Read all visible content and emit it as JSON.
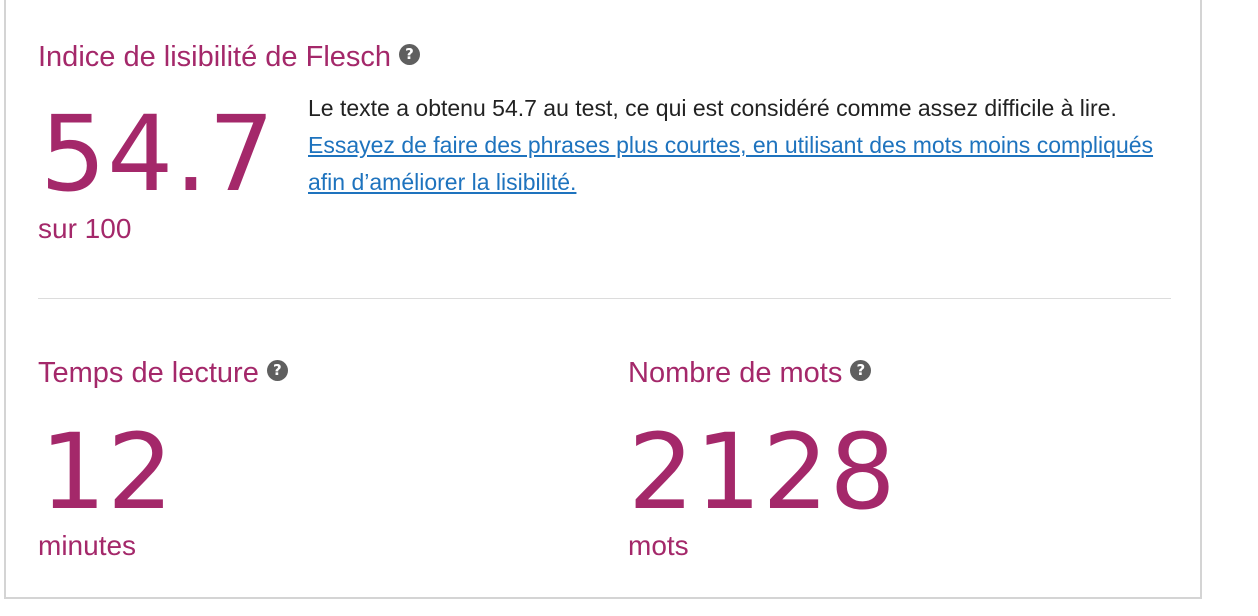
{
  "flesch": {
    "title": "Indice de lisibilité de Flesch",
    "help_icon": "question-circle-icon",
    "score": "54.7",
    "scale": "sur 100",
    "description": "Le texte a obtenu 54.7 au test, ce qui est considéré comme assez difficile à lire.",
    "link_text": "Essayez de faire des phrases plus courtes, en utilisant des mots moins compliqués afin d’améliorer la lisibilité."
  },
  "reading_time": {
    "title": "Temps de lecture",
    "help_icon": "question-circle-icon",
    "value": "12",
    "unit": "minutes"
  },
  "word_count": {
    "title": "Nombre de mots",
    "help_icon": "question-circle-icon",
    "value": "2128",
    "unit": "mots"
  },
  "colors": {
    "accent": "#a4286a",
    "link": "#1e73be",
    "text": "#222222",
    "icon": "#5f5f5f",
    "border": "#d4d4d4"
  }
}
